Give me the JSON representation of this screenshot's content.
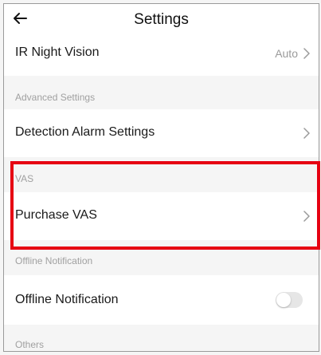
{
  "header": {
    "title": "Settings",
    "back_icon": "back-arrow-icon"
  },
  "ir_night_vision": {
    "label": "IR Night Vision",
    "value": "Auto"
  },
  "advanced_settings": {
    "section_title": "Advanced Settings"
  },
  "detection_alarm": {
    "label": "Detection Alarm Settings"
  },
  "vas": {
    "section_title": "VAS",
    "purchase_label": "Purchase VAS"
  },
  "offline": {
    "section_title": "Offline Notification",
    "label": "Offline Notification",
    "toggle_on": false
  },
  "others": {
    "section_title": "Others"
  },
  "highlight_color": "#e60012"
}
